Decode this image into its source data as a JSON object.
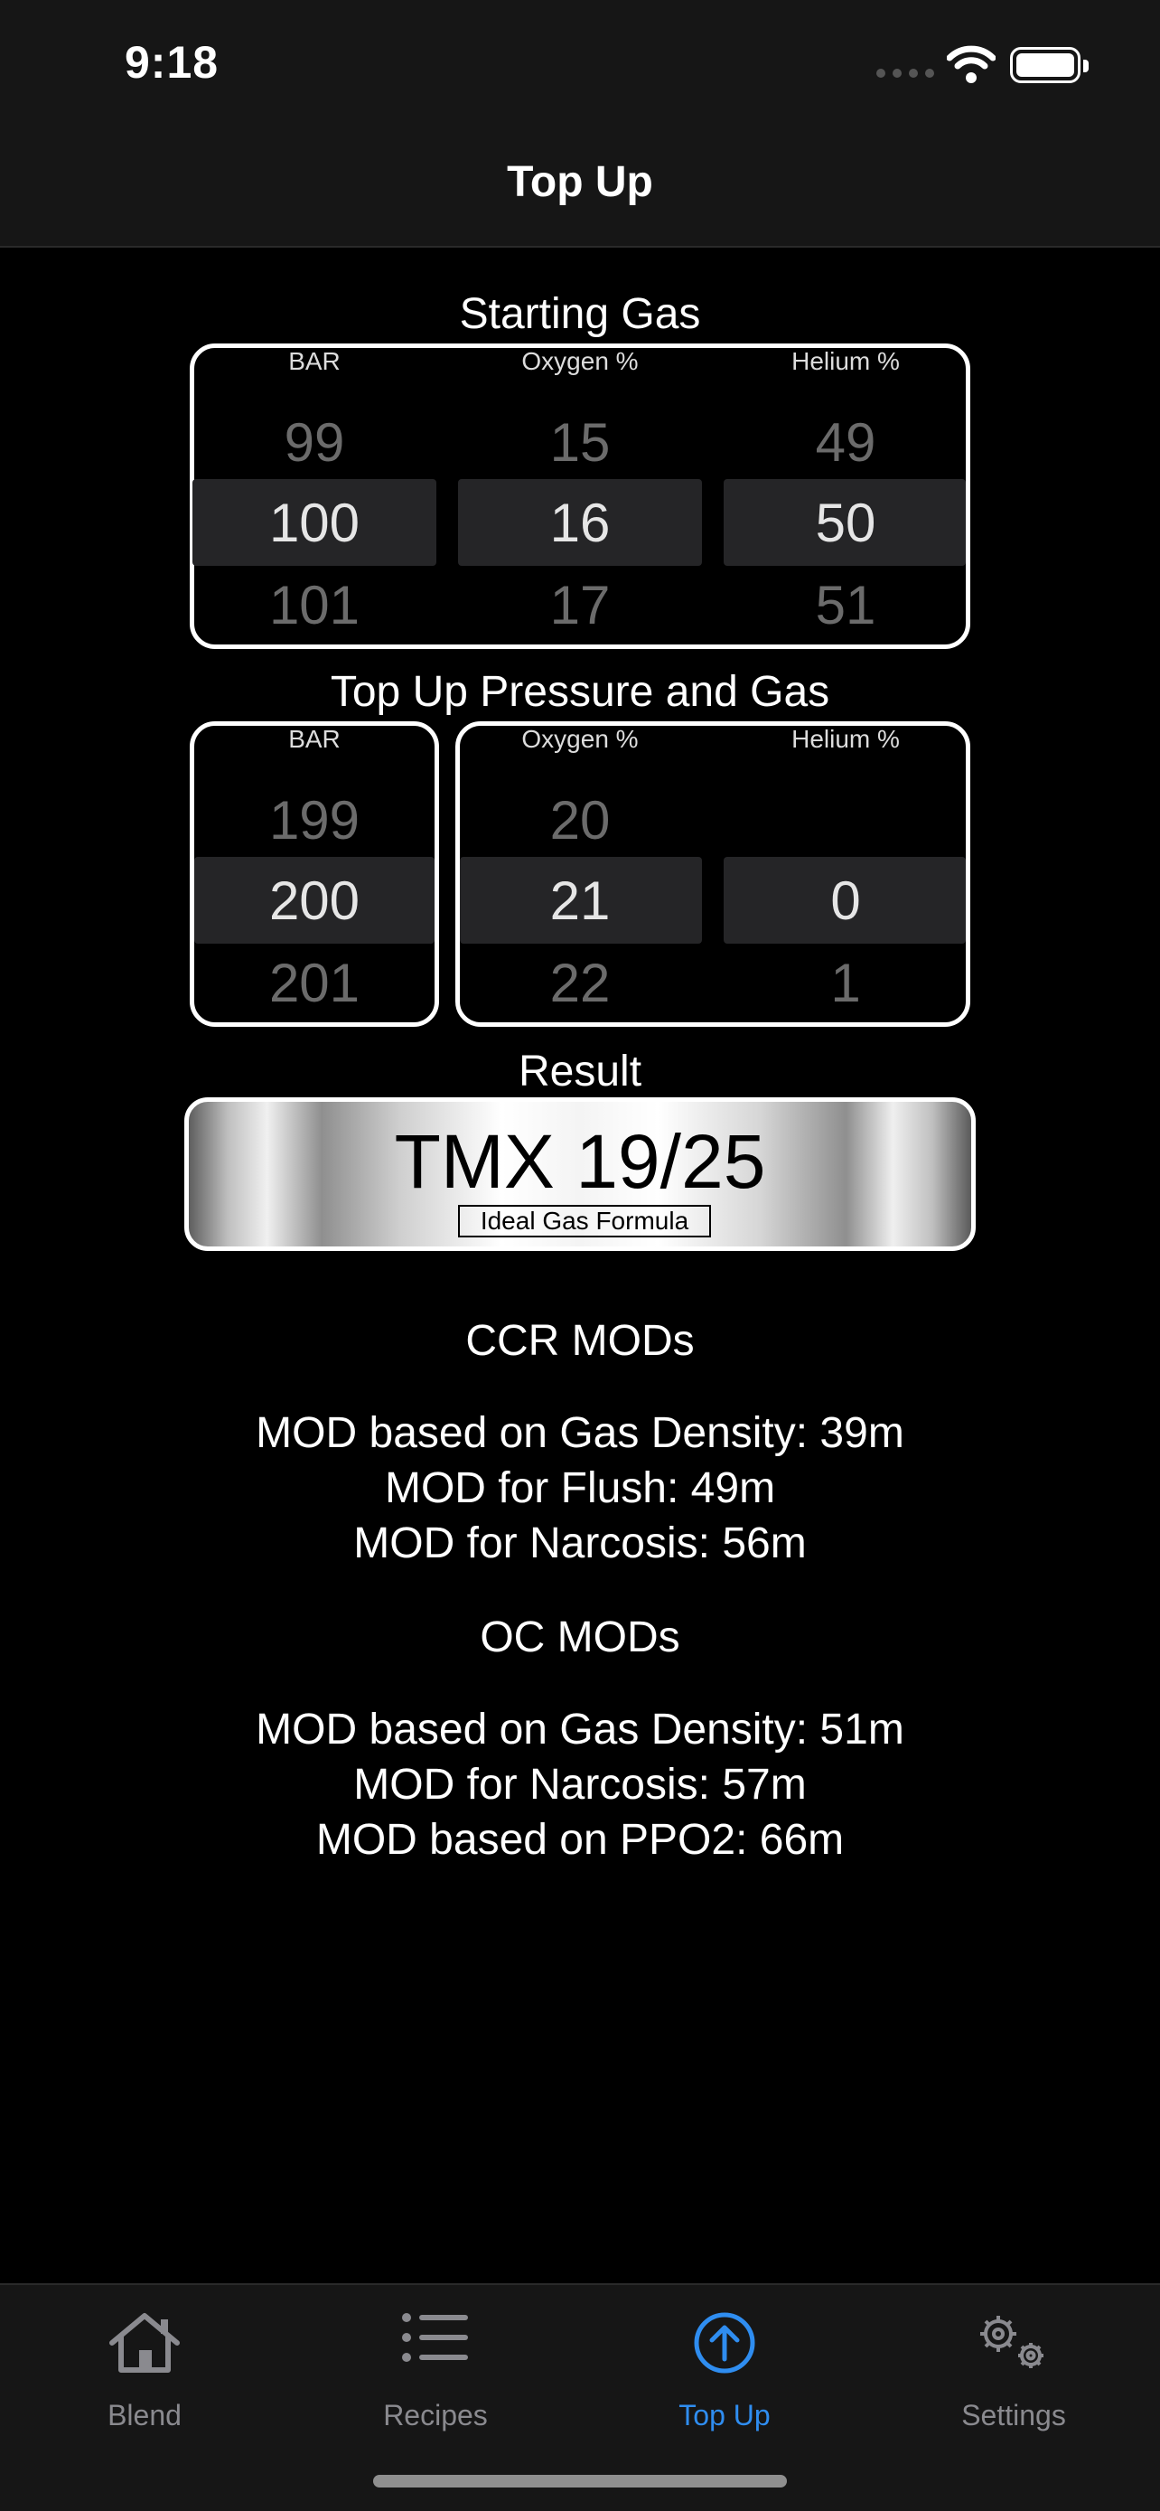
{
  "status": {
    "time": "9:18"
  },
  "nav": {
    "title": "Top Up"
  },
  "starting_gas": {
    "title": "Starting Gas",
    "columns": [
      {
        "header": "BAR",
        "above": "99",
        "selected": "100",
        "below": "101"
      },
      {
        "header": "Oxygen %",
        "above": "15",
        "selected": "16",
        "below": "17"
      },
      {
        "header": "Helium %",
        "above": "49",
        "selected": "50",
        "below": "51"
      }
    ]
  },
  "top_up": {
    "title": "Top Up Pressure and Gas",
    "columns": [
      {
        "header": "BAR",
        "above": "199",
        "selected": "200",
        "below": "201"
      },
      {
        "header": "Oxygen %",
        "above": "20",
        "selected": "21",
        "below": "22"
      },
      {
        "header": "Helium %",
        "above": "",
        "selected": "0",
        "below": "1"
      }
    ]
  },
  "result": {
    "title": "Result",
    "mix": "TMX 19/25",
    "formula": "Ideal Gas Formula"
  },
  "ccr_mods": {
    "heading": "CCR MODs",
    "lines": [
      "MOD based on Gas Density: 39m",
      "MOD for Flush: 49m",
      "MOD for Narcosis: 56m"
    ]
  },
  "oc_mods": {
    "heading": "OC MODs",
    "lines": [
      "MOD based on Gas Density: 51m",
      "MOD for Narcosis: 57m",
      "MOD based on PPO2: 66m"
    ]
  },
  "tabs": [
    {
      "label": "Blend",
      "icon": "house-icon",
      "active": false
    },
    {
      "label": "Recipes",
      "icon": "list-icon",
      "active": false
    },
    {
      "label": "Top Up",
      "icon": "arrow-up-circle-icon",
      "active": true
    },
    {
      "label": "Settings",
      "icon": "gears-icon",
      "active": false
    }
  ],
  "colors": {
    "accent": "#2f8df0",
    "background": "#000000",
    "bar_background": "#161616"
  }
}
